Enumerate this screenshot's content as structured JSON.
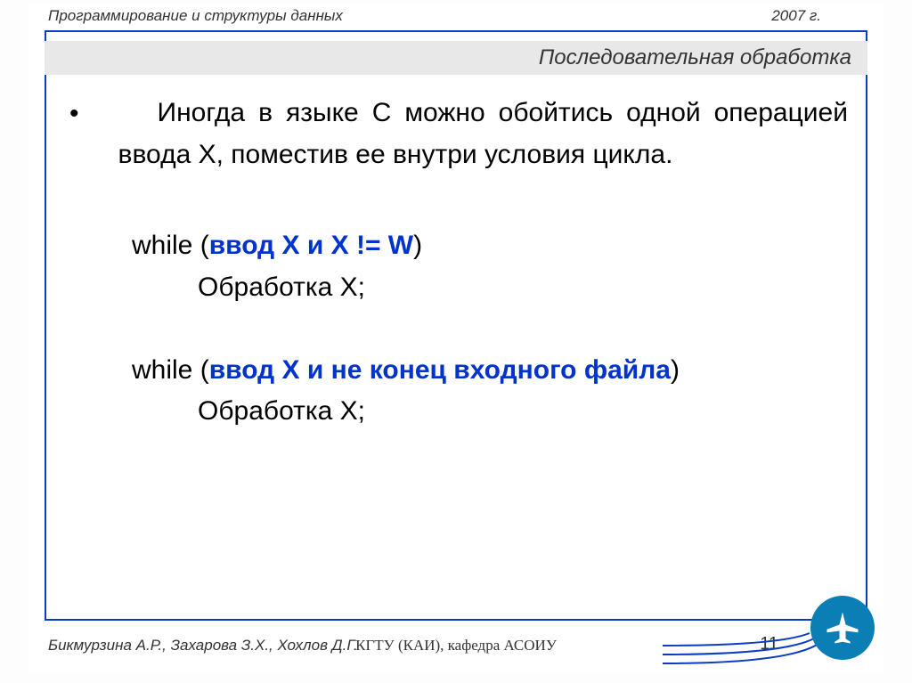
{
  "header": {
    "course_title": "Программирование  и структуры данных",
    "year": "2007 г."
  },
  "subtitle": "Последовательная обработка",
  "content": {
    "paragraph": "Иногда в языке С можно обойтись одной операцией ввода X, поместив ее внутри условия цикла.",
    "code1_while": "while (",
    "code1_cond": "ввод X и X != W",
    "code1_close": ")",
    "code1_body": "Обработка X;",
    "code2_while": "while (",
    "code2_cond": "ввод X и не конец входного файла",
    "code2_close": ")",
    "code2_body": "Обработка X;"
  },
  "footer": {
    "authors": "Бикмурзина А.Р., Захарова З.Х., Хохлов Д.Г.",
    "institution": "КГТУ  (КАИ),  кафедра АСОИУ",
    "page": "11"
  }
}
